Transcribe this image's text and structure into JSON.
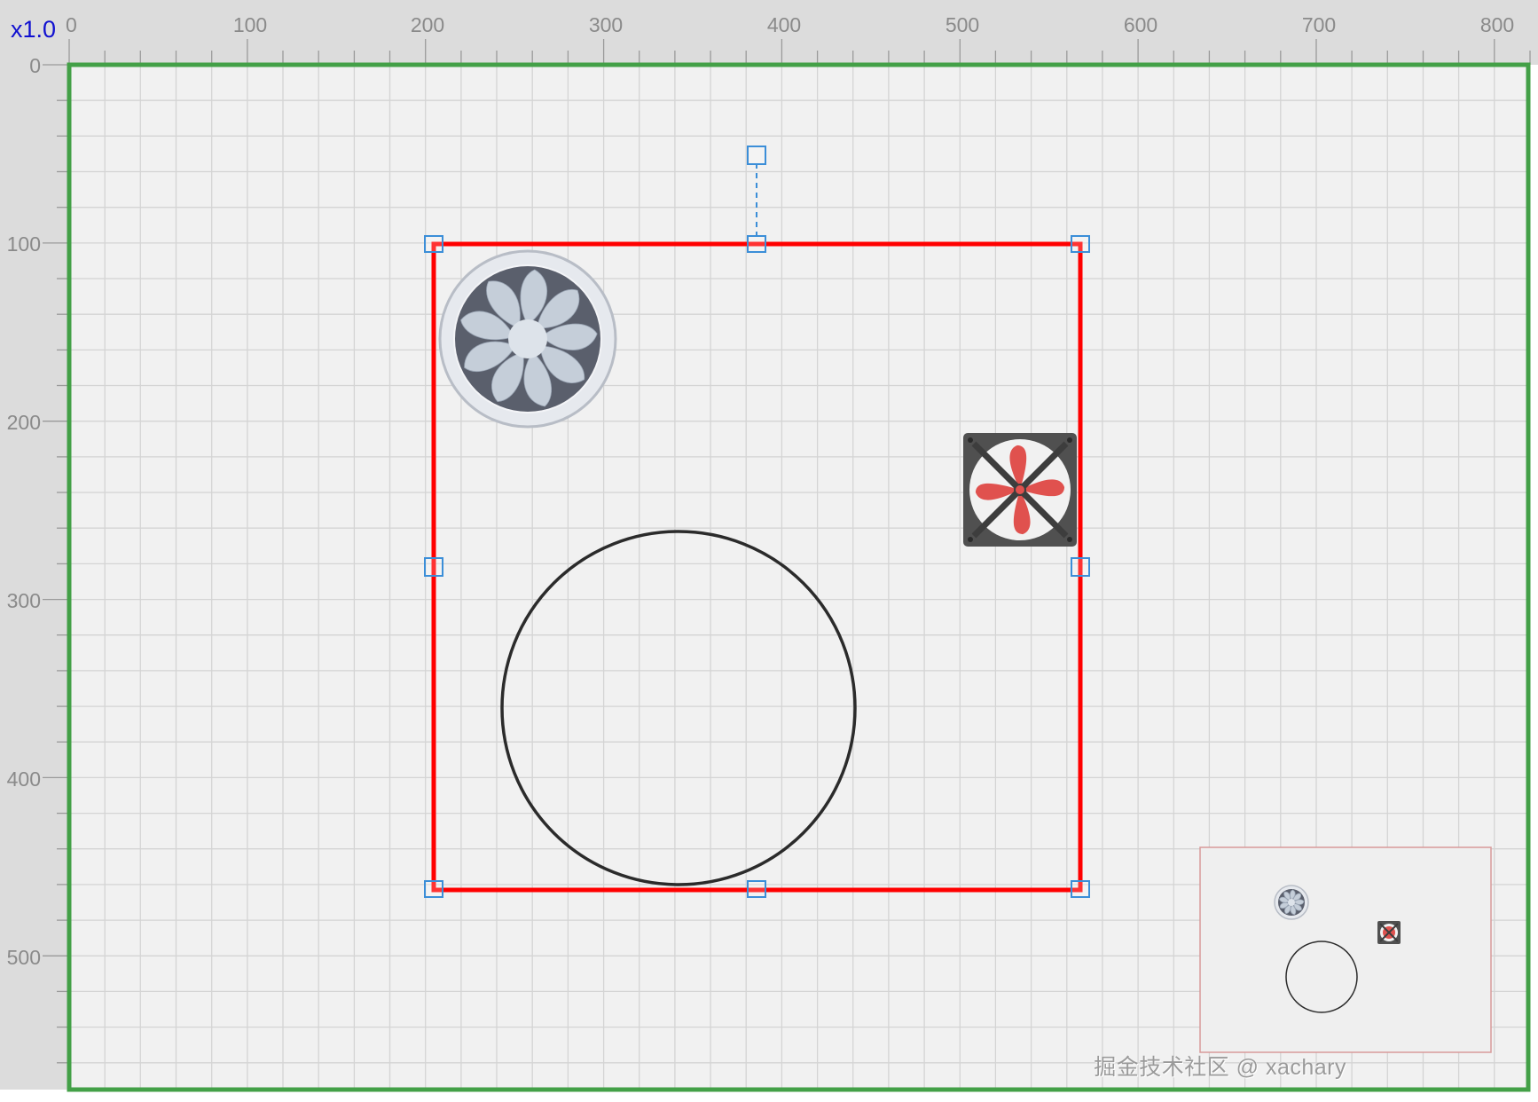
{
  "zoom_label": "x1.0",
  "rulers": {
    "horizontal_ticks": [
      "0",
      "100",
      "200",
      "300",
      "400",
      "500",
      "600",
      "700",
      "800"
    ],
    "vertical_ticks": [
      "0",
      "100",
      "200",
      "300",
      "400",
      "500"
    ]
  },
  "colors": {
    "canvas_border": "#43a047",
    "selection_border": "#ff0000",
    "handle_stroke": "#3b8ed8",
    "ruler_background": "#dcdcdc",
    "canvas_background": "#f1f1f1",
    "grid_line": "#d4d4d4",
    "zoom_label": "#1010d0",
    "minimap_border": "#d89a9a"
  },
  "shapes": [
    {
      "name": "axial-fan",
      "icon": "axial-fan-icon",
      "colors": {
        "ring": "#e6e9ee",
        "housing": "#5a5f6c",
        "blades": "#c5ced9"
      }
    },
    {
      "name": "exhaust-fan",
      "icon": "exhaust-fan-icon",
      "colors": {
        "frame": "#505050",
        "blades": "#e0514e"
      }
    },
    {
      "name": "circle",
      "icon": "circle-shape",
      "colors": {
        "stroke": "#2b2b2b"
      }
    }
  ],
  "minimap": {
    "label": "minimap"
  },
  "watermark": "掘金技术社区 @ xachary"
}
